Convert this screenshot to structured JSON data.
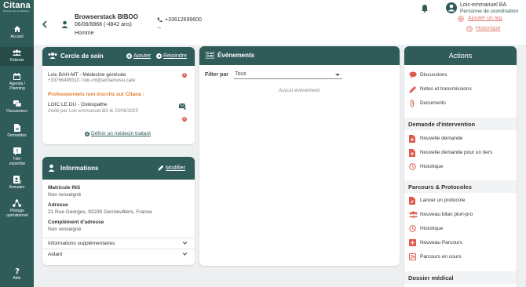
{
  "sidebar": {
    "logo": "Citana",
    "logo_sub": "Parcours de coordination",
    "items": [
      {
        "label": "Accueil",
        "icon": "home-icon"
      },
      {
        "label": "Patients",
        "icon": "patients-icon"
      },
      {
        "label": "Agenda / Planning",
        "icon": "calendar-icon"
      },
      {
        "label": "Discussions",
        "icon": "chat-icon"
      },
      {
        "label": "Demandes",
        "icon": "document-icon"
      },
      {
        "label": "Télé-expertise",
        "icon": "teleexpertise-icon"
      },
      {
        "label": "Annuaire",
        "icon": "directory-icon"
      },
      {
        "label": "Pilotage opérationnel",
        "icon": "network-icon"
      },
      {
        "label": "Aide",
        "icon": "help-icon"
      }
    ]
  },
  "header": {
    "patient_name": "Browserstack BIBOO",
    "patient_dob": "06/06/6868 (-4842 ans)",
    "patient_sex": "Homme",
    "phone": "+33612699600",
    "phone_secondary": "–",
    "user_name": "Loic-emmanuel BA",
    "user_role": "Personne de coordination",
    "add_tag": "Ajouter un tag",
    "history": "Historique"
  },
  "cercle": {
    "title": "Cercle de soin",
    "add": "Ajouter",
    "join": "Rejoindre",
    "member_name": "Loic BAH-MT - Médecine générale",
    "member_contact": "+33766499310 / loic-mt@annamessi.care",
    "pro_heading": "Professionnels non inscrits sur Citana :",
    "pro_name": "LOIC LE DU - Ostéopathe",
    "pro_invite": "Invité par Loic-emmanuel BA le 23/06/2025",
    "add_doctor": "Définir un médecin traitant"
  },
  "informations": {
    "title": "Informations",
    "edit": "Modifier",
    "fields": [
      {
        "label": "Matricule INS",
        "value": "Non renseigné"
      },
      {
        "label": "Adresse",
        "value": "21 Rue Georges, 92230 Gennevilliers, France"
      },
      {
        "label": "Complément d'adresse",
        "value": "Non renseigné"
      }
    ],
    "accordions": [
      "Informations supplémentaires",
      "Aidant"
    ]
  },
  "evenements": {
    "title": "Événements",
    "filter_label": "Filter par",
    "filter_value": "Tous",
    "empty": "Aucun événement"
  },
  "actions": {
    "title": "Actions",
    "items": [
      "Discussions",
      "Notes et transmissions",
      "Documents"
    ],
    "sections": [
      {
        "title": "Demande d'intervention",
        "items": [
          "Nouvelle demande",
          "Nouvelle demande pour un tiers",
          "Historique"
        ]
      },
      {
        "title": "Parcours & Protocoles",
        "items": [
          "Lancer un protocole",
          "Nouveau bilan pluri-pro",
          "Historique",
          "Nouveau Parcours",
          "Parcours en cours"
        ]
      },
      {
        "title": "Dossier médical",
        "items": []
      }
    ]
  },
  "colors": {
    "primary": "#2f5b59",
    "accent": "#e0594e",
    "link": "#e07c6e"
  }
}
